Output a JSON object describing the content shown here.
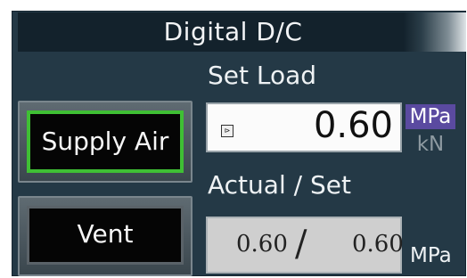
{
  "title": "Digital D/C",
  "set_load": {
    "label": "Set Load",
    "value": "0.60",
    "small_button_glyph": "⊳",
    "units": [
      "MPa",
      "kN"
    ],
    "selected_unit": "MPa"
  },
  "actual_set": {
    "label": "Actual / Set",
    "actual": "0.60",
    "separator": "/",
    "set": "0.60",
    "unit": "MPa"
  },
  "buttons": {
    "supply_air": "Supply Air",
    "vent": "Vent"
  },
  "colors": {
    "panel_bg": "#243946",
    "title_bg": "#13222c",
    "selected_unit_bg": "#5a4aa0",
    "active_border": "#3fbf34"
  }
}
